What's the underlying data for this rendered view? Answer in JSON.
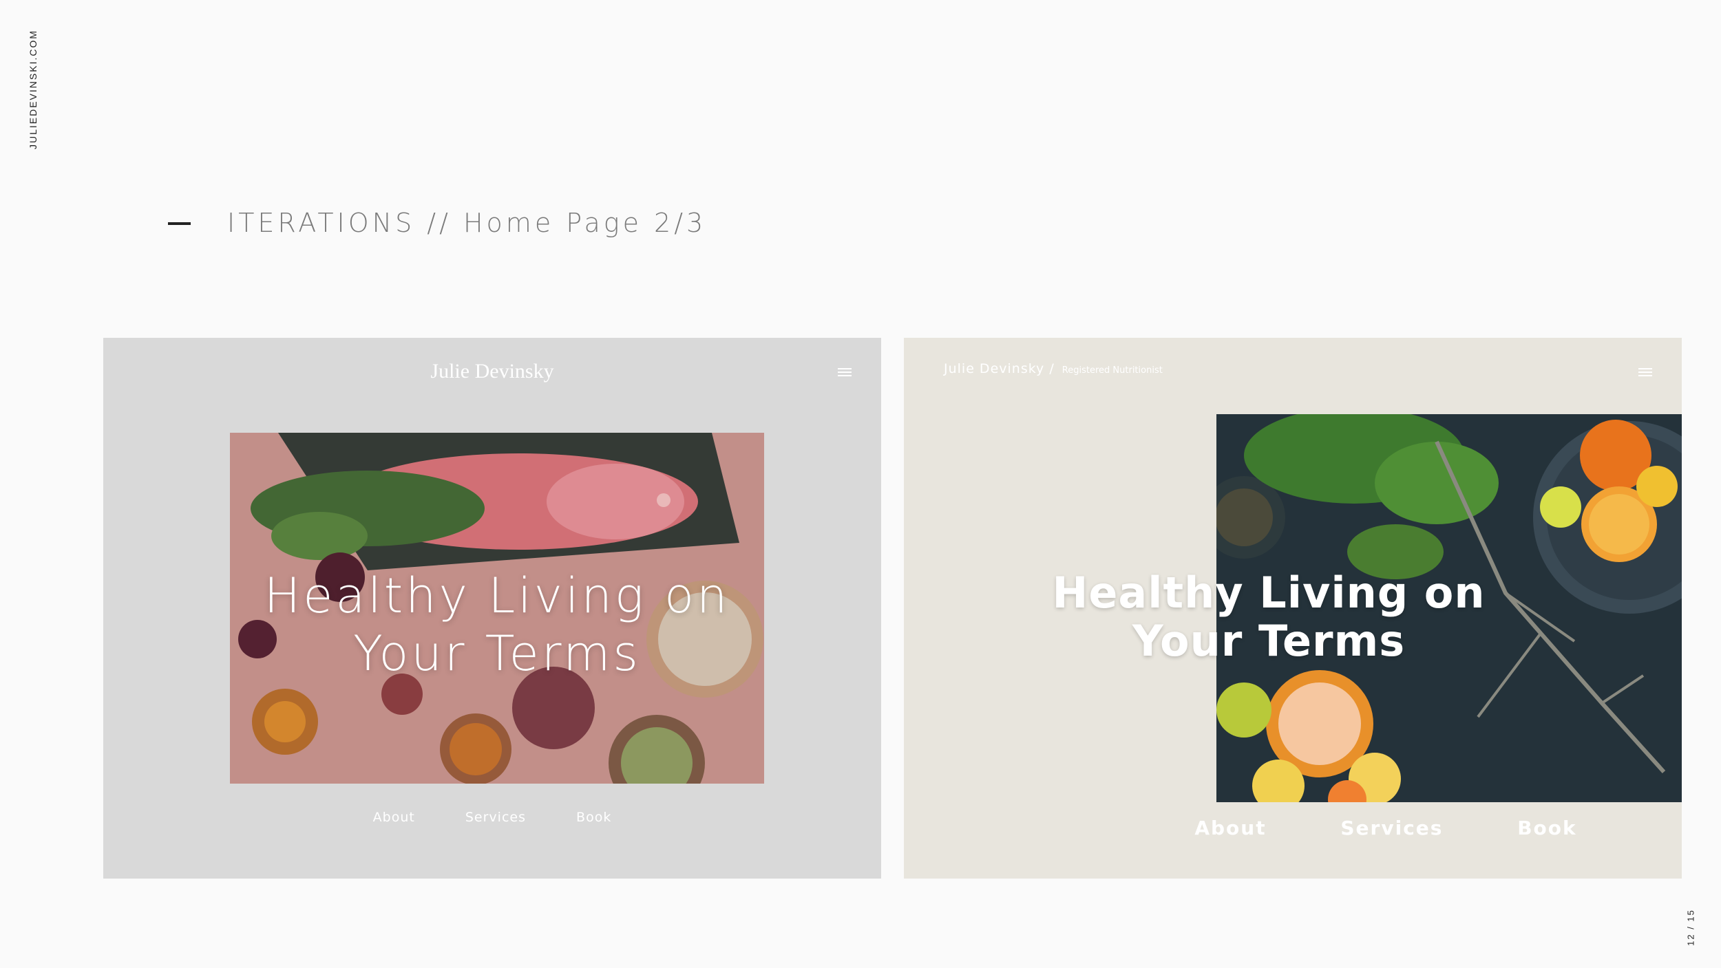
{
  "side_url": "JULIEDEVINSKI.COM",
  "page_counter": "12 / 15",
  "heading": "ITERATIONS // Home Page 2/3",
  "mockup1": {
    "brand": "Julie Devinsky",
    "hero_line1": "Healthy Living on",
    "hero_line2": "Your Terms",
    "nav": [
      "About",
      "Services",
      "Book"
    ],
    "background": "#d9d9d9"
  },
  "mockup2": {
    "brand": "Julie Devinsky",
    "brand_separator": "/",
    "brand_tagline": "Registered Nutritionist",
    "hero_line1": "Healthy Living on",
    "hero_line2": "Your Terms",
    "nav": [
      "About",
      "Services",
      "Book"
    ],
    "background": "#e8e5dd"
  },
  "icons": {
    "menu": "hamburger-menu-icon",
    "dash": "em-dash"
  }
}
